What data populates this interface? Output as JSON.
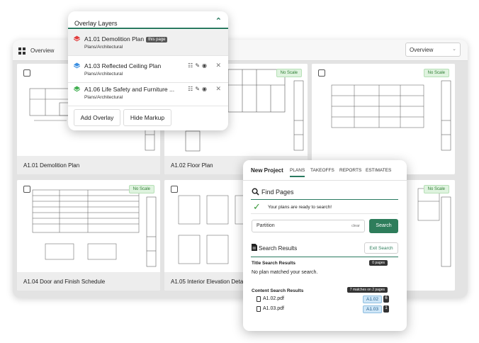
{
  "window": {
    "title": "Overview",
    "view_select": "Overview"
  },
  "sheets": [
    {
      "label": "A1.01 Demolition Plan",
      "no_scale": false
    },
    {
      "label": "A1.02 Floor Plan",
      "no_scale": true
    },
    {
      "label": "",
      "no_scale": true
    },
    {
      "label": "A1.04 Door and Finish Schedule",
      "no_scale": true
    },
    {
      "label": "A1.05 Interior Elevation Details",
      "no_scale": false
    },
    {
      "label": "",
      "no_scale": true
    }
  ],
  "no_scale_text": "No Scale",
  "overlay": {
    "title": "Overlay Layers",
    "layers": [
      {
        "name": "A1.01 Demolition Plan",
        "badge": "this page",
        "sub": "Plans/Architectural",
        "color": "#e23b3b"
      },
      {
        "name": "A1.03 Reflected Ceiling Plan",
        "sub": "Plans/Architectural",
        "color": "#3b8fe2"
      },
      {
        "name": "A1.06 Life Safety and Furniture ...",
        "sub": "Plans/Architectural",
        "color": "#3fae4f"
      }
    ],
    "add_label": "Add Overlay",
    "hide_label": "Hide Markup"
  },
  "search": {
    "project": "New Project",
    "tabs": [
      "PLANS",
      "TAKEOFFS",
      "REPORTS",
      "ESTIMATES"
    ],
    "find_title": "Find Pages",
    "ready_text": "Your plans are ready to search!",
    "query": "Partition",
    "clear_label": "clear",
    "search_label": "Search",
    "results_title": "Search Results",
    "exit_label": "Exit Search",
    "title_section": {
      "label": "Title Search Results",
      "badge": "0 pages",
      "empty": "No plan matched your search."
    },
    "content_section": {
      "label": "Content Search Results",
      "badge": "7 matches on 2 pages",
      "files": [
        {
          "name": "A1.02.pdf",
          "page": "A1.02",
          "count": "6"
        },
        {
          "name": "A1.03.pdf",
          "page": "A1.03",
          "count": "1"
        }
      ]
    }
  }
}
